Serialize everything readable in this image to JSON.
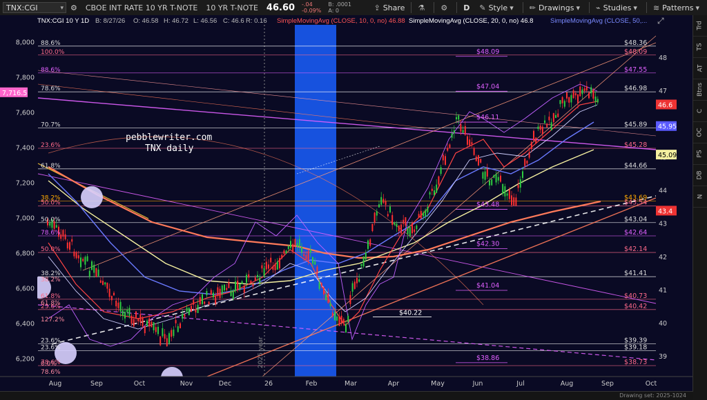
{
  "toolbar": {
    "symbol": "TNX:CGI",
    "symbol_name": "CBOE INT RATE 10 YR T-NOTE",
    "symbol_desc": "10 YR T-NOTE",
    "price": "46.60",
    "change": "-.04",
    "change_pct": "-0.09%",
    "bid": "B: .0001",
    "ask": "A: 0",
    "share_label": "Share",
    "period": "D",
    "style_label": "Style",
    "drawings_label": "Drawings",
    "studies_label": "Studies",
    "patterns_label": "Patterns"
  },
  "header": {
    "symbol": "TNX:CGI 10 Y 1D",
    "date": "B: 8/27/26",
    "open": "O: 46.58",
    "high": "H: 46.72",
    "low": "L: 46.56",
    "close": "C: 46.6",
    "range": "R: 0.16",
    "sma10": "SimpleMovingAvg (CLOSE, 10, 0, no) 46.88",
    "sma20": "SimpleMovingAvg (CLOSE, 20, 0, no) 46.8",
    "sma50": "SimpleMovingAvg (CLOSE, 50,..."
  },
  "watermark": {
    "line1": "pebblewriter.com",
    "line2": "TNX daily",
    "year_text": "2025 year"
  },
  "colors": {
    "background": "#0a0a24",
    "highlight_band": "#1a5fff",
    "magenta": "#e060ff",
    "pink": "#ff6a8a",
    "orange": "#ff7a5a",
    "blue_ma": "#6a7aff",
    "yellow_ma": "#f5f0a0"
  },
  "right_tabs": [
    "Trd",
    "TS",
    "AT",
    "Btns",
    "C",
    "OC",
    "PS",
    "DB",
    "N"
  ],
  "chart_data": {
    "type": "line",
    "title": "TNX:CGI 10 Y 1D",
    "x_labels": [
      "Aug",
      "Sep",
      "Oct",
      "Nov",
      "Dec",
      "26",
      "Feb",
      "Mar",
      "Apr",
      "May",
      "Jun",
      "Jul",
      "Aug",
      "Sep",
      "Oct"
    ],
    "left_axis": {
      "ticks": [
        "8,000",
        "7,800",
        "7,600",
        "7,400",
        "7,200",
        "7,000",
        "6,800",
        "6,600",
        "6,400",
        "6,200"
      ],
      "current_label": "7,716.5",
      "range": [
        6100,
        8100
      ]
    },
    "right_axis": {
      "ticks": [
        "48",
        "47",
        "46",
        "45",
        "44",
        "43",
        "42",
        "41",
        "40",
        "39"
      ],
      "range": [
        38.4,
        49.0
      ]
    },
    "price_tags": [
      {
        "label": "46.6",
        "value": 46.6,
        "color": "#e33"
      },
      {
        "label": "45.95",
        "value": 45.95,
        "color": "#5a5aff"
      },
      {
        "label": "45.09",
        "value": 45.09,
        "color": "#f5f0a0"
      },
      {
        "label": "43.4",
        "value": 43.4,
        "color": "#e33"
      }
    ],
    "levels": [
      {
        "value": 48.36,
        "label": "$48.36",
        "fib": "88.6%",
        "color": "#ffffff",
        "text_color": "#dddddd"
      },
      {
        "value": 48.09,
        "label": "$48.09",
        "fib": "100.0%",
        "color": "#ff6a8a",
        "text_color": "#ff6a8a"
      },
      {
        "value": 47.55,
        "label": "$47.55",
        "fib": "88.6%",
        "color": "#e060ff",
        "text_color": "#e060ff"
      },
      {
        "value": 46.98,
        "label": "$46.98",
        "fib": "78.6%",
        "color": "#ffffff",
        "text_color": "#dddddd"
      },
      {
        "value": 45.89,
        "label": "$45.89",
        "fib": "70.7%",
        "color": "#ffffff",
        "text_color": "#dddddd"
      },
      {
        "value": 45.28,
        "label": "$45.28",
        "fib": "23.6%",
        "color": "#ff6a8a",
        "text_color": "#ff6a8a"
      },
      {
        "value": 44.66,
        "label": "$44.66",
        "fib": "61.8%",
        "color": "#ffffff",
        "text_color": "#dddddd"
      },
      {
        "value": 43.69,
        "label": "$43.69",
        "fib": "38.2%",
        "color": "#ffaa00",
        "text_color": "#ffaa00"
      },
      {
        "value": 43.54,
        "label": "$43.54",
        "fib": "50.0%",
        "color": "#ff6a8a",
        "text_color": "#ff6a8a"
      },
      {
        "value": 43.04,
        "label": "$43.04",
        "fib": "50.0%",
        "color": "#ffffff",
        "text_color": "#dddddd"
      },
      {
        "value": 42.64,
        "label": "$42.64",
        "fib": "78.6%",
        "color": "#e060ff",
        "text_color": "#e060ff"
      },
      {
        "value": 42.14,
        "label": "$42.14",
        "fib": "50.0%",
        "color": "#ff6a8a",
        "text_color": "#ff6a8a"
      },
      {
        "value": 41.41,
        "label": "$41.41",
        "fib": "38.2%",
        "color": "#ffffff",
        "text_color": "#dddddd"
      },
      {
        "value": 40.73,
        "label": "$40.73",
        "fib": "61.8%",
        "color": "#ff6a8a",
        "text_color": "#ff6a8a"
      },
      {
        "value": 40.42,
        "label": "$40.42",
        "fib": "23.6%",
        "color": "#ff6a8a",
        "text_color": "#ff6a8a"
      },
      {
        "value": 39.39,
        "label": "$39.39",
        "fib": "23.6%",
        "color": "#ffffff",
        "text_color": "#dddddd"
      },
      {
        "value": 39.18,
        "label": "$39.18",
        "fib": "23.6%",
        "color": "#ffffff",
        "text_color": "#dddddd"
      },
      {
        "value": 38.73,
        "label": "$38.73",
        "fib": "78.6%",
        "color": "#ff6a8a",
        "text_color": "#ff6a8a"
      }
    ],
    "mid_labels": [
      {
        "label": "$48.09",
        "value": 48.09,
        "color": "#e060ff"
      },
      {
        "label": "$47.04",
        "value": 47.04,
        "color": "#e060ff"
      },
      {
        "label": "$46.11",
        "value": 46.11,
        "color": "#e060ff"
      },
      {
        "label": "$43.48",
        "value": 43.48,
        "color": "#e060ff"
      },
      {
        "label": "$42.30",
        "value": 42.3,
        "color": "#e060ff"
      },
      {
        "label": "$41.04",
        "value": 41.04,
        "color": "#e060ff"
      },
      {
        "label": "$40.22",
        "value": 40.22,
        "color": "#ffffff"
      },
      {
        "label": "$38.86",
        "value": 38.86,
        "color": "#e060ff"
      }
    ],
    "extra_fib_labels": [
      "127.2%",
      "0.0%",
      "78.6%",
      "38.2%",
      "61.8%"
    ],
    "bottom_status": "Drawing set: 2025-1024"
  }
}
